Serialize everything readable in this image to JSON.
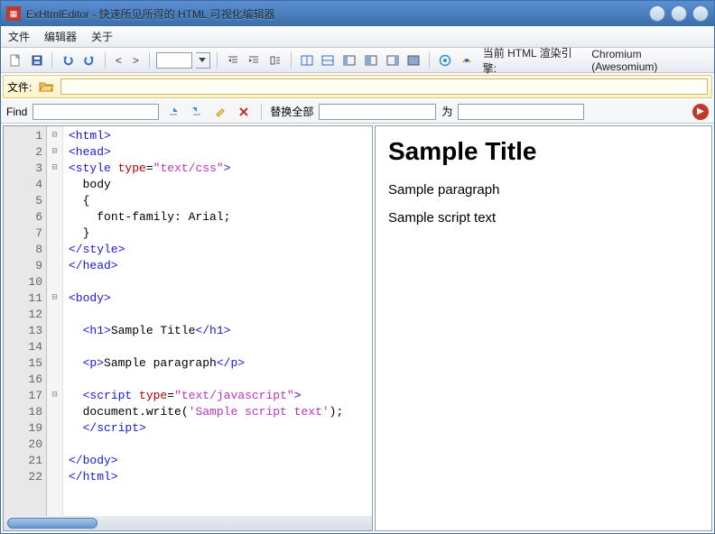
{
  "window": {
    "title": "ExHtmlEditor - 快速所见所得的 HTML 可视化编辑器"
  },
  "menu": {
    "file": "文件",
    "editor": "编辑器",
    "about": "关于"
  },
  "toolbar": {
    "nav_prev": "<",
    "nav_next": ">",
    "zoom_value": "",
    "engine_label": "当前 HTML 渲染引擎:",
    "engine_value": "Chromium (Awesomium)"
  },
  "filebar": {
    "label": "文件:",
    "path": ""
  },
  "findbar": {
    "find_label": "Find",
    "find_value": "",
    "replace_all_label": "替换全部",
    "replace_from": "",
    "to_label": "为",
    "replace_to": ""
  },
  "code": {
    "lines": [
      {
        "n": 1,
        "fold": "⊟",
        "html": "<span class='tag'>&lt;html&gt;</span>"
      },
      {
        "n": 2,
        "fold": "⊟",
        "html": "<span class='tag'>&lt;head&gt;</span>"
      },
      {
        "n": 3,
        "fold": "⊟",
        "html": "<span class='tag'>&lt;style</span> <span class='attr'>type</span>=<span class='str'>\"text/css\"</span><span class='tag'>&gt;</span>"
      },
      {
        "n": 4,
        "fold": "",
        "html": "  <span class='txt'>body</span>"
      },
      {
        "n": 5,
        "fold": "",
        "html": "  <span class='txt'>{</span>"
      },
      {
        "n": 6,
        "fold": "",
        "html": "    <span class='txt'>font-family: Arial;</span>"
      },
      {
        "n": 7,
        "fold": "",
        "html": "  <span class='txt'>}</span>"
      },
      {
        "n": 8,
        "fold": "",
        "html": "<span class='tag'>&lt;/style&gt;</span>"
      },
      {
        "n": 9,
        "fold": "",
        "html": "<span class='tag'>&lt;/head&gt;</span>"
      },
      {
        "n": 10,
        "fold": "",
        "html": ""
      },
      {
        "n": 11,
        "fold": "⊟",
        "html": "<span class='tag'>&lt;body&gt;</span>"
      },
      {
        "n": 12,
        "fold": "",
        "html": ""
      },
      {
        "n": 13,
        "fold": "",
        "html": "  <span class='tag'>&lt;h1&gt;</span><span class='txt'>Sample Title</span><span class='tag'>&lt;/h1&gt;</span>"
      },
      {
        "n": 14,
        "fold": "",
        "html": ""
      },
      {
        "n": 15,
        "fold": "",
        "html": "  <span class='tag'>&lt;p&gt;</span><span class='txt'>Sample paragraph</span><span class='tag'>&lt;/p&gt;</span>"
      },
      {
        "n": 16,
        "fold": "",
        "html": ""
      },
      {
        "n": 17,
        "fold": "⊟",
        "html": "  <span class='tag'>&lt;script</span> <span class='attr'>type</span>=<span class='str'>\"text/javascript\"</span><span class='tag'>&gt;</span>"
      },
      {
        "n": 18,
        "fold": "",
        "html": "  <span class='txt'>document.write(</span><span class='str'>'Sample script text'</span><span class='txt'>);</span>"
      },
      {
        "n": 19,
        "fold": "",
        "html": "  <span class='tag'>&lt;/script&gt;</span>"
      },
      {
        "n": 20,
        "fold": "",
        "html": ""
      },
      {
        "n": 21,
        "fold": "",
        "html": "<span class='tag'>&lt;/body&gt;</span>"
      },
      {
        "n": 22,
        "fold": "",
        "html": "<span class='tag'>&lt;/html&gt;</span>"
      }
    ]
  },
  "preview": {
    "title": "Sample Title",
    "paragraph": "Sample paragraph",
    "script_text": "Sample script text"
  }
}
